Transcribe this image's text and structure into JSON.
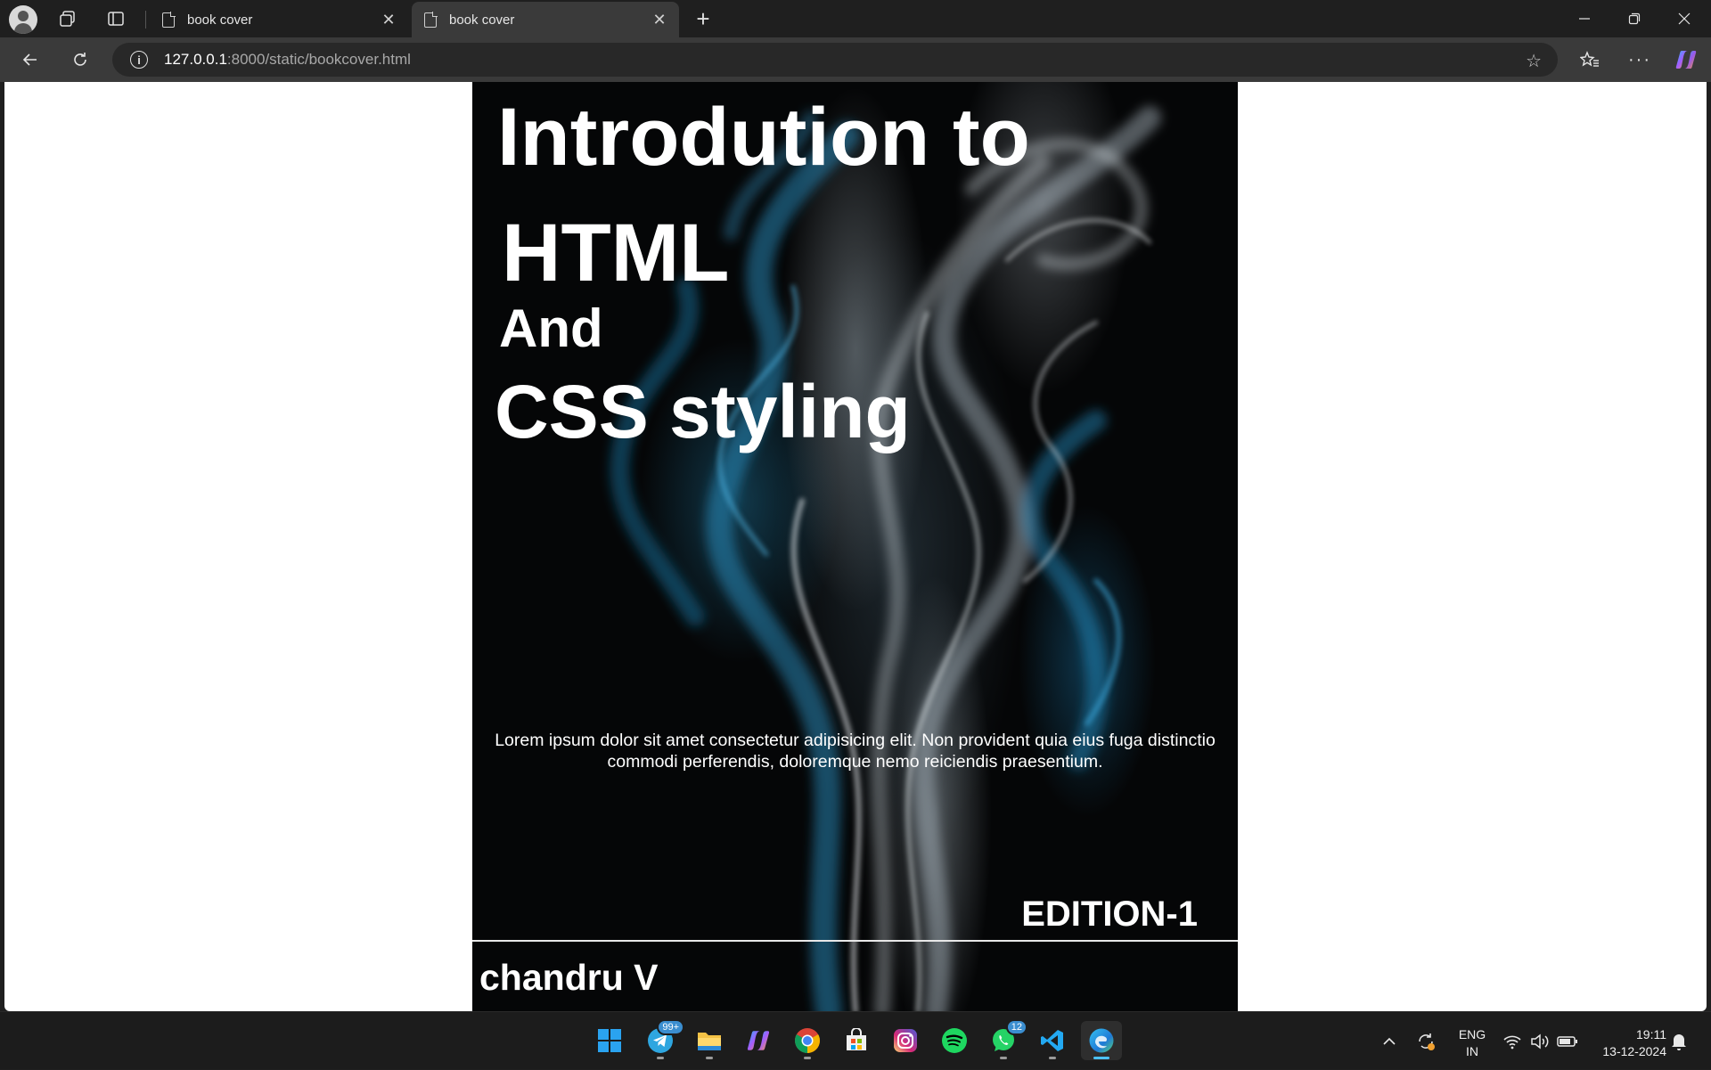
{
  "browser": {
    "tabs": [
      {
        "title": "book cover",
        "active": false
      },
      {
        "title": "book cover",
        "active": true
      }
    ],
    "url_host": "127.0.0.1",
    "url_rest": ":8000/static/bookcover.html"
  },
  "cover": {
    "title_line1": "Introdution to",
    "title_line2": "HTML",
    "title_line3": "And",
    "title_line4": "CSS styling",
    "blurb": "Lorem ipsum dolor sit amet consectetur adipisicing elit. Non provident quia eius fuga distinctio commodi perferendis, doloremque nemo reiciendis praesentium.",
    "edition": "EDITION-1",
    "author": "chandru V"
  },
  "taskbar": {
    "apps": [
      {
        "name": "start",
        "icon": "windows-icon"
      },
      {
        "name": "telegram",
        "icon": "telegram-icon",
        "badge": "99+"
      },
      {
        "name": "file-explorer",
        "icon": "folder-icon"
      },
      {
        "name": "copilot",
        "icon": "copilot-icon"
      },
      {
        "name": "chrome",
        "icon": "chrome-icon"
      },
      {
        "name": "microsoft-store",
        "icon": "store-icon"
      },
      {
        "name": "instagram",
        "icon": "instagram-icon"
      },
      {
        "name": "spotify",
        "icon": "spotify-icon"
      },
      {
        "name": "whatsapp",
        "icon": "whatsapp-icon",
        "badge": "12"
      },
      {
        "name": "vscode",
        "icon": "vscode-icon"
      },
      {
        "name": "edge",
        "icon": "edge-icon"
      }
    ],
    "lang_line1": "ENG",
    "lang_line2": "IN",
    "time": "19:11",
    "date": "13-12-2024"
  },
  "colors": {
    "chrome_bg": "#1f1f1f",
    "toolbar_bg": "#3a3a3a",
    "cover_bg": "#050607",
    "smoke_blue": "#2a9fd6"
  }
}
